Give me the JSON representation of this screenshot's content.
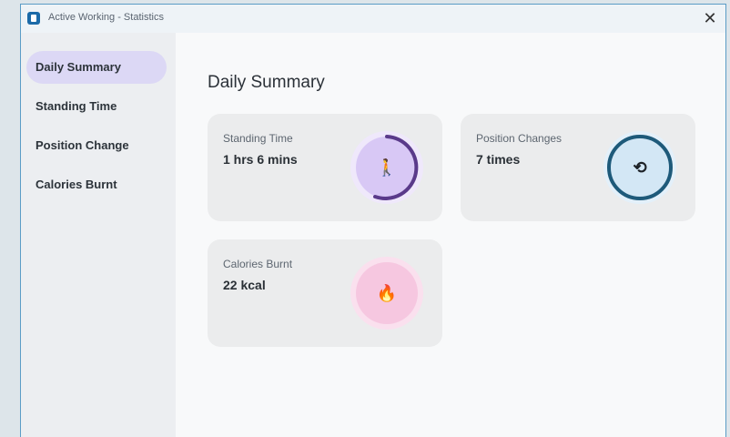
{
  "window": {
    "title": "Active Working - Statistics",
    "close_label": "✕"
  },
  "sidebar": {
    "items": [
      {
        "label": "Daily Summary",
        "active": true
      },
      {
        "label": "Standing Time",
        "active": false
      },
      {
        "label": "Position Change",
        "active": false
      },
      {
        "label": "Calories Burnt",
        "active": false
      }
    ]
  },
  "main": {
    "title": "Daily Summary",
    "cards": {
      "standing": {
        "label": "Standing Time",
        "value": "1 hrs 6 mins",
        "icon": "standing-person-icon",
        "glyph": "🚶",
        "color": "#5a3a8a",
        "fill": "#d8c8f5"
      },
      "position": {
        "label": "Position Changes",
        "value": "7 times",
        "icon": "refresh-arrows-icon",
        "glyph": "⟲",
        "color": "#1e5a7a",
        "fill": "#d3e7f5"
      },
      "calories": {
        "label": "Calories Burnt",
        "value": "22 kcal",
        "icon": "flame-icon",
        "glyph": "🔥",
        "color": "#e8a9cc",
        "fill": "#f6c7e0"
      }
    }
  }
}
